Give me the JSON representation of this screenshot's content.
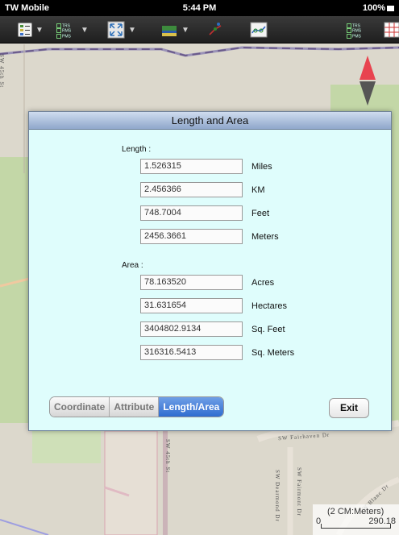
{
  "status_bar": {
    "carrier": "TW Mobile",
    "time": "5:44 PM",
    "battery": "100%"
  },
  "map": {
    "road_labels": [
      "SW Fairhaven Dr",
      "SW 45th St",
      "SW Dearmond Dr",
      "SW Fairmont Dr",
      "SW Blanc Dr"
    ],
    "scale": {
      "title": "(2 CM:Meters)",
      "min": "0",
      "max": "290.18"
    }
  },
  "dialog": {
    "title": "Length and Area",
    "length": {
      "label": "Length :",
      "rows": [
        {
          "value": "1.526315",
          "unit": "Miles"
        },
        {
          "value": "2.456366",
          "unit": "KM"
        },
        {
          "value": "748.7004",
          "unit": "Feet"
        },
        {
          "value": "2456.3661",
          "unit": "Meters"
        }
      ]
    },
    "area": {
      "label": "Area :",
      "rows": [
        {
          "value": "78.163520",
          "unit": "Acres"
        },
        {
          "value": "31.631654",
          "unit": "Hectares"
        },
        {
          "value": "3404802.9134",
          "unit": "Sq. Feet"
        },
        {
          "value": "316316.5413",
          "unit": "Sq. Meters"
        }
      ]
    },
    "tabs": [
      {
        "label": "Coordinate",
        "active": false
      },
      {
        "label": "Attribute",
        "active": false
      },
      {
        "label": "Length/Area",
        "active": true
      }
    ],
    "exit_label": "Exit"
  },
  "layer_legend": [
    "TRS",
    "RMS",
    "PMS"
  ],
  "colors": {
    "accent": "#2f6cd0",
    "dialog_bg": "#dffdfc",
    "compass_north": "#e8434f",
    "compass_south": "#555555"
  }
}
